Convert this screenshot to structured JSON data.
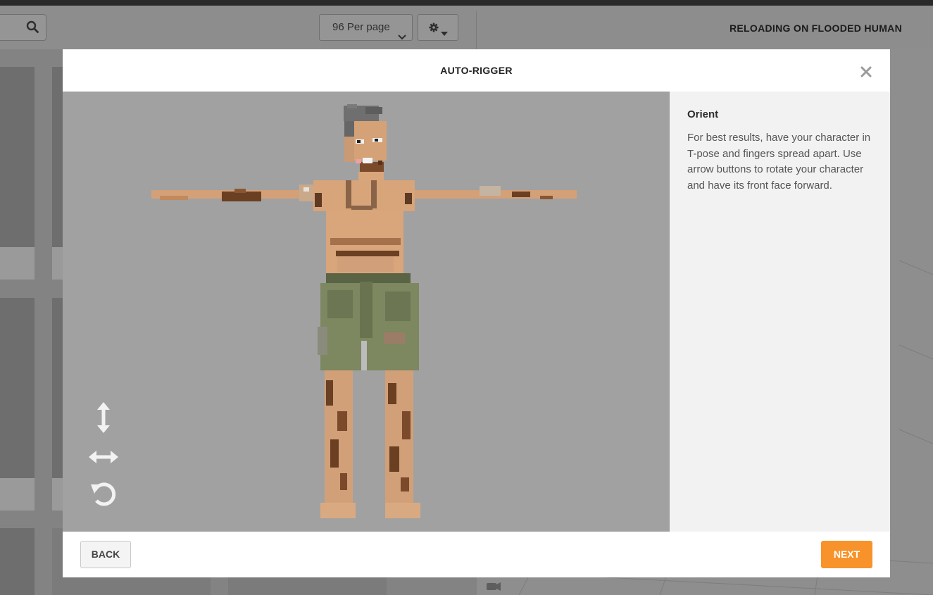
{
  "background": {
    "per_page_label": "96 Per page",
    "right_panel_title": "RELOADING ON FLOODED HUMAN",
    "icons": [
      "search-icon",
      "chevron-down-icon",
      "gear-icon",
      "caret-down-icon",
      "camera-icon"
    ]
  },
  "modal": {
    "title": "AUTO-RIGGER",
    "close_icon": "close-icon",
    "step": {
      "title": "Orient",
      "description": "For best results, have your character in T-pose and fingers spread apart. Use arrow buttons to rotate your character and have its front face forward."
    },
    "controls": [
      "rotate-vertical-icon",
      "rotate-horizontal-icon",
      "rotate-reset-icon"
    ],
    "footer": {
      "back_label": "BACK",
      "next_label": "NEXT"
    }
  },
  "colors": {
    "accent": "#f7932a",
    "stage_bg": "#a1a1a1",
    "panel_bg": "#f2f2f2"
  }
}
